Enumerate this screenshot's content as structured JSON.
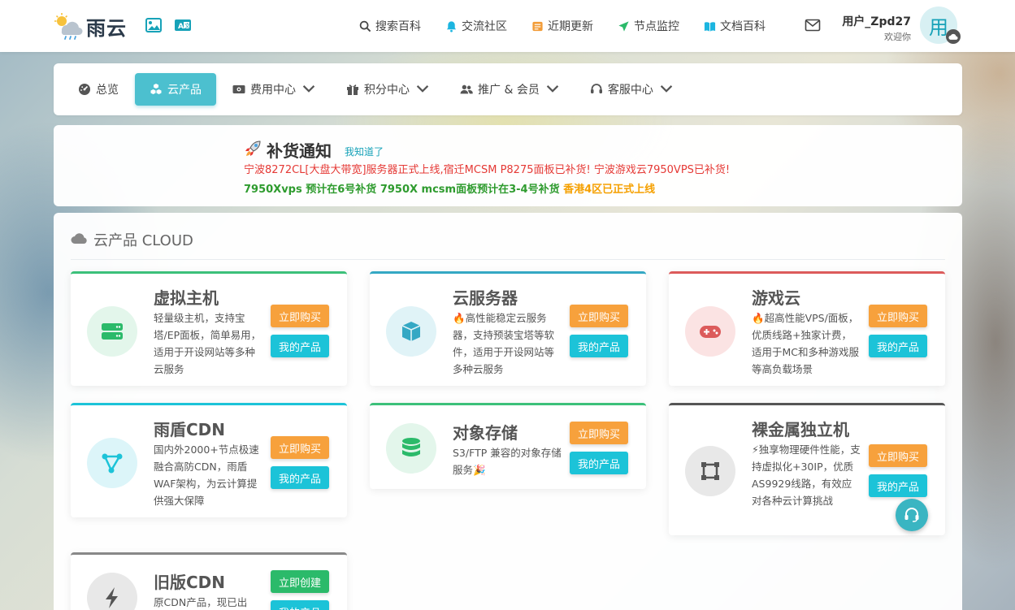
{
  "header": {
    "logo_text": "雨云",
    "nav": [
      {
        "label": "搜索百科",
        "icon": "search-icon"
      },
      {
        "label": "交流社区",
        "icon": "bell-icon"
      },
      {
        "label": "近期更新",
        "icon": "notes-icon"
      },
      {
        "label": "节点监控",
        "icon": "send-icon"
      },
      {
        "label": "文档百科",
        "icon": "book-icon"
      }
    ],
    "user_name": "用户_Zpd27",
    "user_sub": "欢迎你",
    "avatar_char": "用"
  },
  "menu": [
    {
      "label": "总览",
      "icon": "dashboard-icon",
      "dropdown": false
    },
    {
      "label": "云产品",
      "icon": "cubes-icon",
      "dropdown": false,
      "active": true
    },
    {
      "label": "费用中心",
      "icon": "money-icon",
      "dropdown": true
    },
    {
      "label": "积分中心",
      "icon": "gift-icon",
      "dropdown": true
    },
    {
      "label": "推广 & 会员",
      "icon": "users-icon",
      "dropdown": true
    },
    {
      "label": "客服中心",
      "icon": "headset-icon",
      "dropdown": true
    }
  ],
  "notice": {
    "title": "补货通知",
    "ack": "我知道了",
    "line1": "宁波8272CL[大盘大带宽]服务器正式上线,宿迁MCSM P8275面板已补货! 宁波游戏云7950VPS已补货!",
    "line2_green": "7950Xvps 预计在6号补货 7950X mcsm面板预计在3-4号补货",
    "line2_orange": "香港4区已正式上线"
  },
  "panel": {
    "title": "云产品 CLOUD"
  },
  "products": [
    {
      "title": "虚拟主机",
      "desc": "轻量级主机，支持宝塔/EP面板，简单易用，适用于开设网站等多种云服务",
      "btn1": "立即购买",
      "btn2": "我的产品",
      "accent": "#3cc07a",
      "icon": "server-icon"
    },
    {
      "title": "云服务器",
      "desc": "🔥高性能稳定云服务器，支持预装宝塔等软件，适用于开设网站等多种云服务",
      "btn1": "立即购买",
      "btn2": "我的产品",
      "accent": "#34a8c4",
      "icon": "box-icon"
    },
    {
      "title": "游戏云",
      "desc": "🔥超高性能VPS/面板，优质线路+独家计费，适用于MC和多种游戏服等高负载场景",
      "btn1": "立即购买",
      "btn2": "我的产品",
      "accent": "#dc5b5b",
      "icon": "gamepad-icon"
    },
    {
      "title": "雨盾CDN",
      "desc": "国内外2000+节点极速融合高防CDN，雨盾WAF架构，为云计算提供强大保障",
      "btn1": "立即购买",
      "btn2": "我的产品",
      "accent": "#1cc3d8",
      "icon": "network-icon"
    },
    {
      "title": "对象存储",
      "desc": "S3/FTP 兼容的对象存储服务🎉",
      "btn1": "立即购买",
      "btn2": "我的产品",
      "accent": "#3cc07a",
      "icon": "database-icon"
    },
    {
      "title": "裸金属独立机",
      "desc": "⚡独享物理硬件性能，支持虚拟化+30IP，优质AS9929线路，有效应对各种云计算挑战",
      "btn1": "立即购买",
      "btn2": "我的产品",
      "accent": "#555555",
      "icon": "frame-icon"
    },
    {
      "title": "旧版CDN",
      "desc": "原CDN产品，现已出",
      "btn1": "立即创建",
      "btn2": "我的产品",
      "accent": "#888888",
      "icon": "bolt-icon"
    }
  ]
}
